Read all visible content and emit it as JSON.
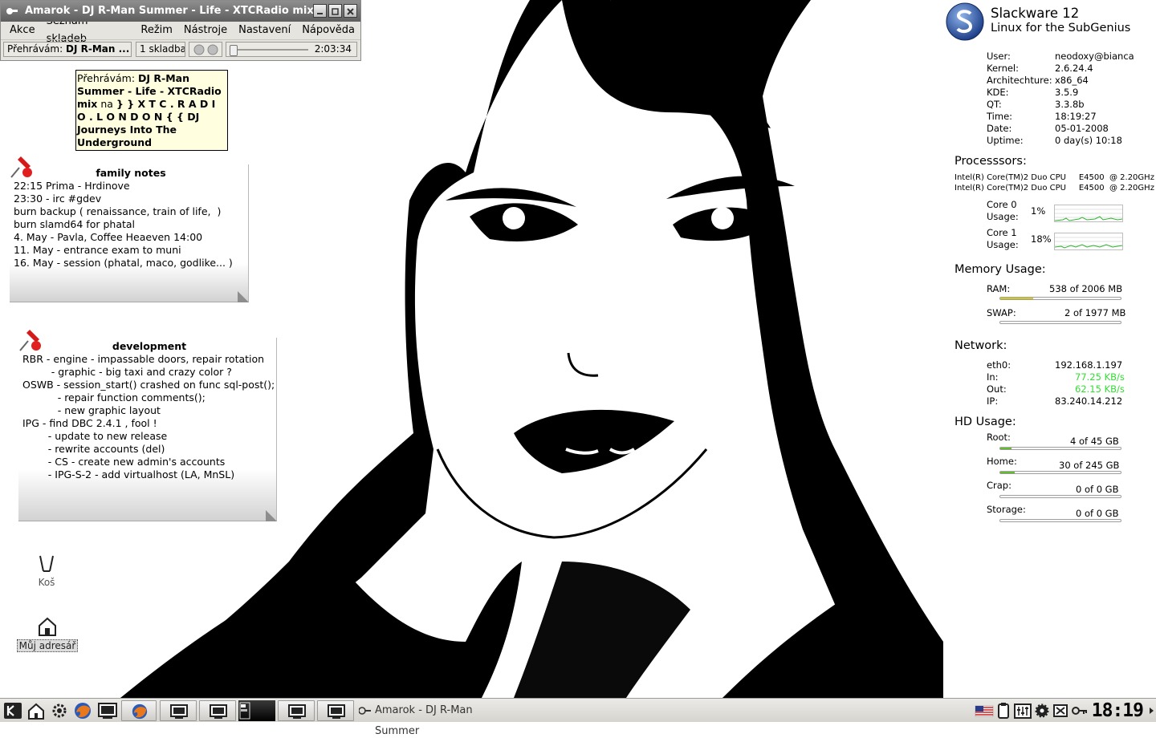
{
  "amarok": {
    "title": "Amarok - DJ R-Man Summer  - Life - XTCRadio mix",
    "menu": [
      "Akce",
      "Seznam skladeb",
      "Režim",
      "Nástroje",
      "Nastavení",
      "Nápověda"
    ],
    "now_playing_label": "Přehrávám:",
    "now_playing_value": "DJ R-Man ...",
    "track_count": "1 skladba",
    "time": "2:03:34"
  },
  "osd": {
    "label": "Přehrávám:",
    "text": "DJ R-Man Summer - Life - XTCRadio mix",
    "on": "na",
    "station": "} } X T C . R A D I O . L O N D O N { { DJ Journeys Into The Underground"
  },
  "notes": [
    {
      "title": "family notes",
      "lines": [
        "22:15 Prima - Hrdinove",
        "23:30 - irc #gdev",
        "",
        "burn backup ( renaissance, train of life,  )",
        "burn slamd64 for phatal",
        "",
        "4. May - Pavla, Coffee Heaeven 14:00",
        "11. May - entrance exam to muni",
        "16. May - session (phatal, maco, godlike... )"
      ]
    },
    {
      "title": "development",
      "lines": [
        "RBR - engine - impassable doors, repair rotation",
        "         - graphic - big taxi and crazy color ?",
        "",
        "OSWB - session_start() crashed on func sql-post();",
        "           - repair function comments();",
        "           - new graphic layout",
        "",
        "IPG - find DBC 2.4.1 , fool !",
        "        - update to new release",
        "        - rewrite accounts (del)",
        "        - CS - create new admin's accounts",
        "        - IPG-S-2 - add virtualhost (LA, MnSL)"
      ]
    }
  ],
  "desktop_icons": {
    "trash": "Koš",
    "home": "Můj adresář"
  },
  "conky": {
    "distro": "Slackware 12",
    "tagline": "Linux for the SubGenius",
    "sys": [
      {
        "k": "User:",
        "v": "neodoxy@bianca"
      },
      {
        "k": "Kernel:",
        "v": "2.6.24.4"
      },
      {
        "k": "Architechture:",
        "v": "x86_64"
      },
      {
        "k": "KDE:",
        "v": "3.5.9"
      },
      {
        "k": "QT:",
        "v": "3.3.8b"
      },
      {
        "k": "Time:",
        "v": "18:19:27"
      },
      {
        "k": "Date:",
        "v": "05-01-2008"
      },
      {
        "k": "Uptime:",
        "v": "0 day(s)  10:18"
      }
    ],
    "processors_head": "Processsors:",
    "cpus": [
      "Intel(R) Core(TM)2 Duo CPU     E4500  @ 2.20GHz",
      "Intel(R) Core(TM)2 Duo CPU     E4500  @ 2.20GHz"
    ],
    "cores": [
      {
        "name": "Core 0",
        "usage_label": "Usage:",
        "usage": "1%"
      },
      {
        "name": "Core 1",
        "usage_label": "Usage:",
        "usage": "18%"
      }
    ],
    "memory_head": "Memory Usage:",
    "ram_label": "RAM:",
    "ram_value": "538 of 2006 MB",
    "ram_frac": 0.27,
    "swap_label": "SWAP:",
    "swap_value": "2 of 1977 MB",
    "swap_frac": 0.0,
    "network_head": "Network:",
    "net": [
      {
        "k": "eth0:",
        "v": "192.168.1.197"
      },
      {
        "k": "In:",
        "v": "77.25 KB/s"
      },
      {
        "k": "Out:",
        "v": "62.15 KB/s"
      },
      {
        "k": "IP:",
        "v": "83.240.14.212"
      }
    ],
    "net_accent": "#33dd33",
    "hd_head": "HD Usage:",
    "disks": [
      {
        "k": "Root:",
        "v": "4 of 45 GB",
        "frac": 0.09
      },
      {
        "k": "Home:",
        "v": "30 of 245 GB",
        "frac": 0.12
      },
      {
        "k": "Crap:",
        "v": "0 of 0 GB",
        "frac": 0.0
      },
      {
        "k": "Storage:",
        "v": "0 of 0 GB",
        "frac": 0.0
      }
    ]
  },
  "taskbar": {
    "active_task": "Amarok - DJ R-Man Summer",
    "clock": "18:19",
    "icons": [
      "kde-menu-icon",
      "home-folder-icon",
      "control-center-icon",
      "firefox-icon",
      "konsole-icon",
      "us-flag-icon",
      "clipboard-icon",
      "kmix-icon",
      "settings-icon",
      "network-icon"
    ]
  }
}
